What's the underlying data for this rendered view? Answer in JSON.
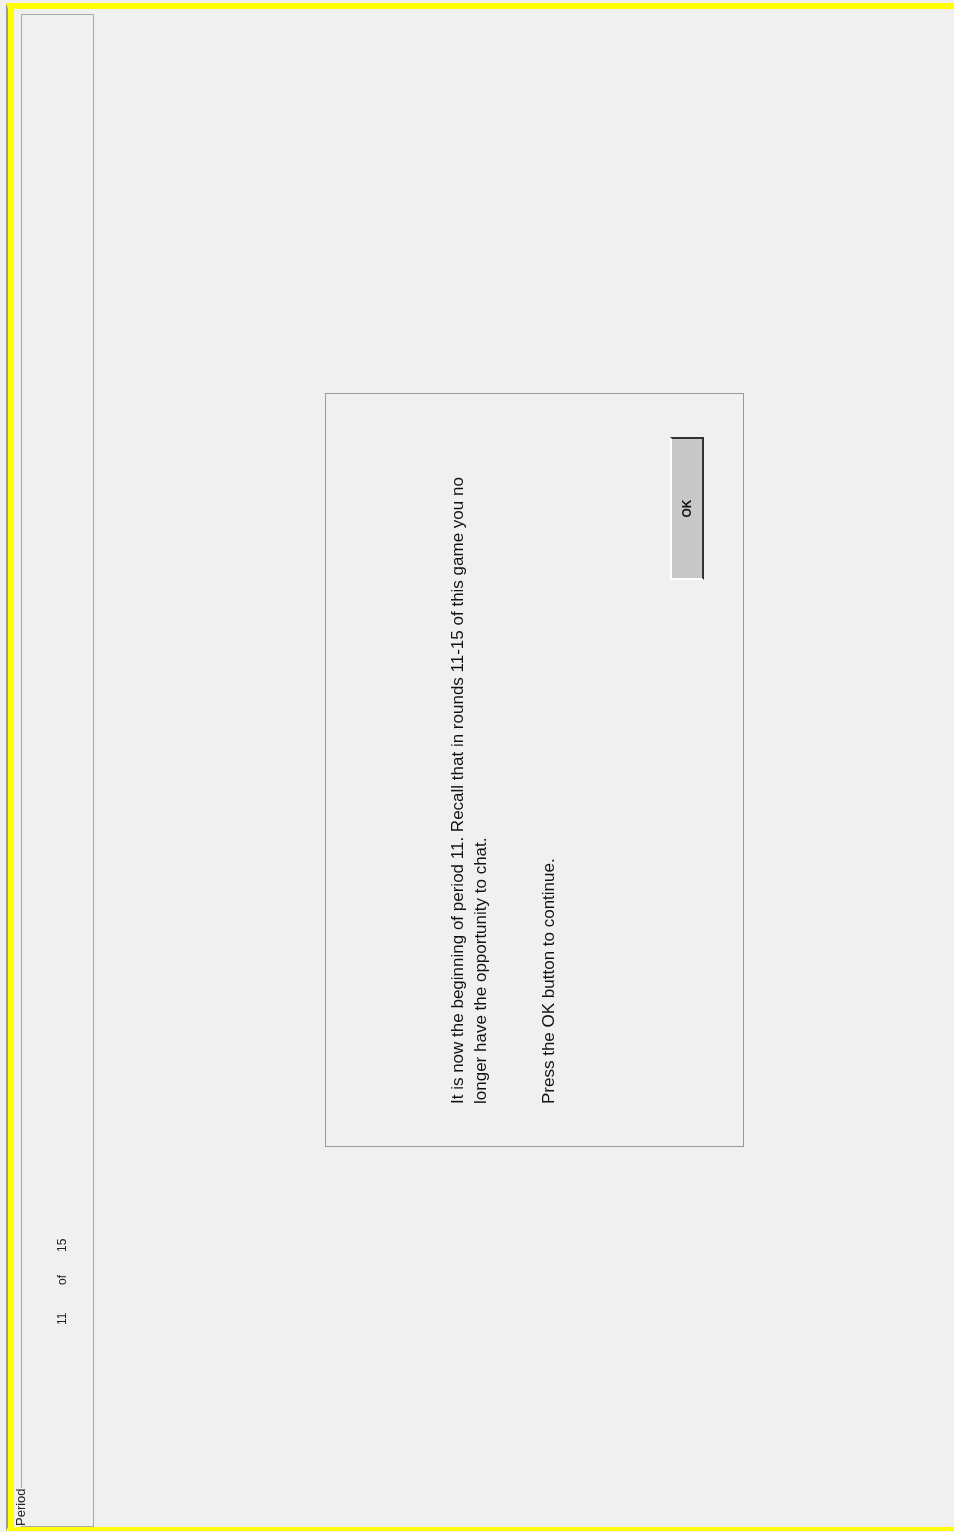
{
  "period_panel": {
    "title": "Period",
    "current": "11",
    "separator": "of",
    "total": "15"
  },
  "dialog": {
    "message": "It is now the beginning of period 11. Recall that in rounds 11-15 of this game you no longer have the opportunity to chat.",
    "instruction": "Press the OK button to continue.",
    "button": "OK"
  }
}
